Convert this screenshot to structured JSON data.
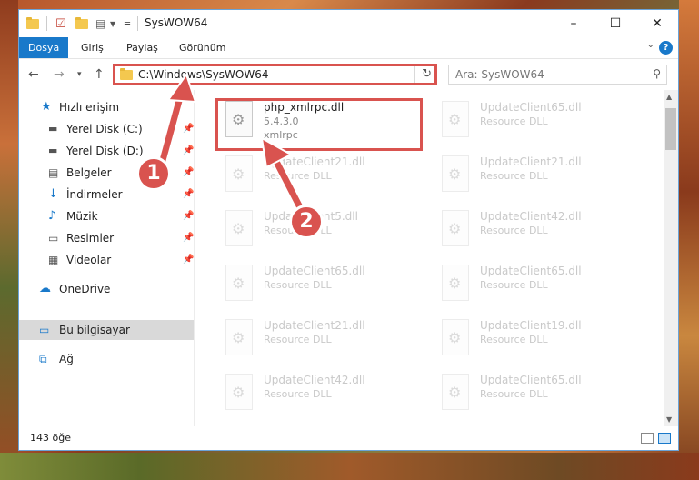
{
  "window": {
    "title": "SysWOW64",
    "controls": {
      "minimize": "–",
      "maximize": "☐",
      "close": "✕"
    }
  },
  "ribbon": {
    "tabs": [
      {
        "label": "Dosya",
        "active": true
      },
      {
        "label": "Giriş",
        "active": false
      },
      {
        "label": "Paylaş",
        "active": false
      },
      {
        "label": "Görünüm",
        "active": false
      }
    ],
    "help": "?"
  },
  "address": {
    "path": "C:\\Windows\\SysWOW64",
    "search_placeholder": "Ara: SysWOW64"
  },
  "nav": {
    "items": [
      {
        "label": "Hızlı erişim",
        "icon": "star-icon",
        "pinned": false
      },
      {
        "label": "Yerel Disk (C:)",
        "icon": "drive-icon",
        "pinned": true
      },
      {
        "label": "Yerel Disk (D:)",
        "icon": "drive-icon",
        "pinned": true
      },
      {
        "label": "Belgeler",
        "icon": "documents-icon",
        "pinned": true
      },
      {
        "label": "İndirmeler",
        "icon": "download-icon",
        "pinned": true
      },
      {
        "label": "Müzik",
        "icon": "music-icon",
        "pinned": true
      },
      {
        "label": "Resimler",
        "icon": "pictures-icon",
        "pinned": true
      },
      {
        "label": "Videolar",
        "icon": "videos-icon",
        "pinned": true
      },
      {
        "label": "OneDrive",
        "icon": "cloud-icon",
        "pinned": false
      },
      {
        "label": "Bu bilgisayar",
        "icon": "computer-icon",
        "pinned": false,
        "selected": true
      },
      {
        "label": "Ağ",
        "icon": "network-icon",
        "pinned": false
      }
    ]
  },
  "files": [
    {
      "name": "php_xmlrpc.dll",
      "line1": "5.4.3.0",
      "line2": "xmlrpc",
      "highlighted": true
    },
    {
      "name": "UpdateClient65.dll",
      "line1": "Resource DLL",
      "line2": ""
    },
    {
      "name": "UpdateClient21.dll",
      "line1": "Resource DLL",
      "line2": ""
    },
    {
      "name": "UpdateClient21.dll",
      "line1": "Resource DLL",
      "line2": ""
    },
    {
      "name": "UpdateClient5.dll",
      "line1": "Resource DLL",
      "line2": ""
    },
    {
      "name": "UpdateClient42.dll",
      "line1": "Resource DLL",
      "line2": ""
    },
    {
      "name": "UpdateClient65.dll",
      "line1": "Resource DLL",
      "line2": ""
    },
    {
      "name": "UpdateClient65.dll",
      "line1": "Resource DLL",
      "line2": ""
    },
    {
      "name": "UpdateClient21.dll",
      "line1": "Resource DLL",
      "line2": ""
    },
    {
      "name": "UpdateClient19.dll",
      "line1": "Resource DLL",
      "line2": ""
    },
    {
      "name": "UpdateClient42.dll",
      "line1": "Resource DLL",
      "line2": ""
    },
    {
      "name": "UpdateClient65.dll",
      "line1": "Resource DLL",
      "line2": ""
    }
  ],
  "status": {
    "count": "143 öğe"
  },
  "annotations": {
    "step1": "1",
    "step2": "2",
    "color": "#d9534f"
  }
}
